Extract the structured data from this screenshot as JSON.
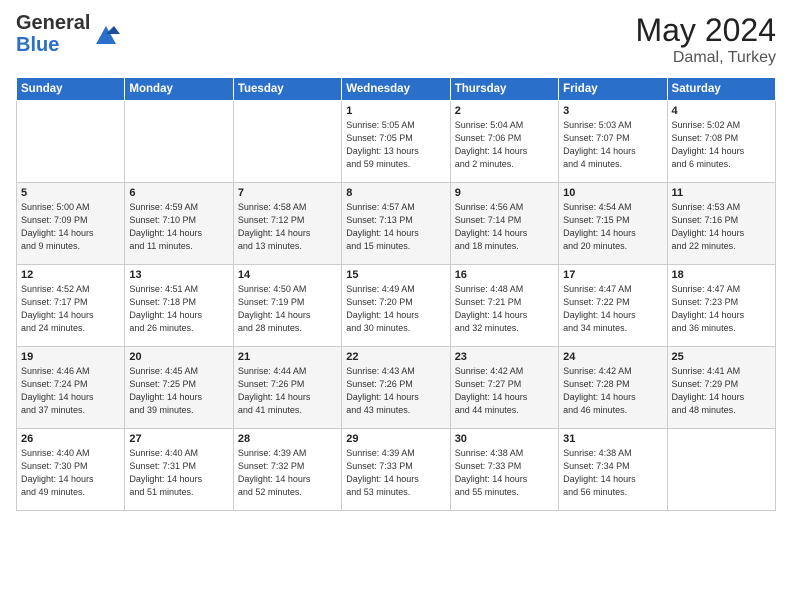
{
  "header": {
    "title": "May 2024",
    "location": "Damal, Turkey",
    "logo_general": "General",
    "logo_blue": "Blue"
  },
  "days_of_week": [
    "Sunday",
    "Monday",
    "Tuesday",
    "Wednesday",
    "Thursday",
    "Friday",
    "Saturday"
  ],
  "weeks": [
    [
      {
        "day": "",
        "detail": ""
      },
      {
        "day": "",
        "detail": ""
      },
      {
        "day": "",
        "detail": ""
      },
      {
        "day": "1",
        "detail": "Sunrise: 5:05 AM\nSunset: 7:05 PM\nDaylight: 13 hours\nand 59 minutes."
      },
      {
        "day": "2",
        "detail": "Sunrise: 5:04 AM\nSunset: 7:06 PM\nDaylight: 14 hours\nand 2 minutes."
      },
      {
        "day": "3",
        "detail": "Sunrise: 5:03 AM\nSunset: 7:07 PM\nDaylight: 14 hours\nand 4 minutes."
      },
      {
        "day": "4",
        "detail": "Sunrise: 5:02 AM\nSunset: 7:08 PM\nDaylight: 14 hours\nand 6 minutes."
      }
    ],
    [
      {
        "day": "5",
        "detail": "Sunrise: 5:00 AM\nSunset: 7:09 PM\nDaylight: 14 hours\nand 9 minutes."
      },
      {
        "day": "6",
        "detail": "Sunrise: 4:59 AM\nSunset: 7:10 PM\nDaylight: 14 hours\nand 11 minutes."
      },
      {
        "day": "7",
        "detail": "Sunrise: 4:58 AM\nSunset: 7:12 PM\nDaylight: 14 hours\nand 13 minutes."
      },
      {
        "day": "8",
        "detail": "Sunrise: 4:57 AM\nSunset: 7:13 PM\nDaylight: 14 hours\nand 15 minutes."
      },
      {
        "day": "9",
        "detail": "Sunrise: 4:56 AM\nSunset: 7:14 PM\nDaylight: 14 hours\nand 18 minutes."
      },
      {
        "day": "10",
        "detail": "Sunrise: 4:54 AM\nSunset: 7:15 PM\nDaylight: 14 hours\nand 20 minutes."
      },
      {
        "day": "11",
        "detail": "Sunrise: 4:53 AM\nSunset: 7:16 PM\nDaylight: 14 hours\nand 22 minutes."
      }
    ],
    [
      {
        "day": "12",
        "detail": "Sunrise: 4:52 AM\nSunset: 7:17 PM\nDaylight: 14 hours\nand 24 minutes."
      },
      {
        "day": "13",
        "detail": "Sunrise: 4:51 AM\nSunset: 7:18 PM\nDaylight: 14 hours\nand 26 minutes."
      },
      {
        "day": "14",
        "detail": "Sunrise: 4:50 AM\nSunset: 7:19 PM\nDaylight: 14 hours\nand 28 minutes."
      },
      {
        "day": "15",
        "detail": "Sunrise: 4:49 AM\nSunset: 7:20 PM\nDaylight: 14 hours\nand 30 minutes."
      },
      {
        "day": "16",
        "detail": "Sunrise: 4:48 AM\nSunset: 7:21 PM\nDaylight: 14 hours\nand 32 minutes."
      },
      {
        "day": "17",
        "detail": "Sunrise: 4:47 AM\nSunset: 7:22 PM\nDaylight: 14 hours\nand 34 minutes."
      },
      {
        "day": "18",
        "detail": "Sunrise: 4:47 AM\nSunset: 7:23 PM\nDaylight: 14 hours\nand 36 minutes."
      }
    ],
    [
      {
        "day": "19",
        "detail": "Sunrise: 4:46 AM\nSunset: 7:24 PM\nDaylight: 14 hours\nand 37 minutes."
      },
      {
        "day": "20",
        "detail": "Sunrise: 4:45 AM\nSunset: 7:25 PM\nDaylight: 14 hours\nand 39 minutes."
      },
      {
        "day": "21",
        "detail": "Sunrise: 4:44 AM\nSunset: 7:26 PM\nDaylight: 14 hours\nand 41 minutes."
      },
      {
        "day": "22",
        "detail": "Sunrise: 4:43 AM\nSunset: 7:26 PM\nDaylight: 14 hours\nand 43 minutes."
      },
      {
        "day": "23",
        "detail": "Sunrise: 4:42 AM\nSunset: 7:27 PM\nDaylight: 14 hours\nand 44 minutes."
      },
      {
        "day": "24",
        "detail": "Sunrise: 4:42 AM\nSunset: 7:28 PM\nDaylight: 14 hours\nand 46 minutes."
      },
      {
        "day": "25",
        "detail": "Sunrise: 4:41 AM\nSunset: 7:29 PM\nDaylight: 14 hours\nand 48 minutes."
      }
    ],
    [
      {
        "day": "26",
        "detail": "Sunrise: 4:40 AM\nSunset: 7:30 PM\nDaylight: 14 hours\nand 49 minutes."
      },
      {
        "day": "27",
        "detail": "Sunrise: 4:40 AM\nSunset: 7:31 PM\nDaylight: 14 hours\nand 51 minutes."
      },
      {
        "day": "28",
        "detail": "Sunrise: 4:39 AM\nSunset: 7:32 PM\nDaylight: 14 hours\nand 52 minutes."
      },
      {
        "day": "29",
        "detail": "Sunrise: 4:39 AM\nSunset: 7:33 PM\nDaylight: 14 hours\nand 53 minutes."
      },
      {
        "day": "30",
        "detail": "Sunrise: 4:38 AM\nSunset: 7:33 PM\nDaylight: 14 hours\nand 55 minutes."
      },
      {
        "day": "31",
        "detail": "Sunrise: 4:38 AM\nSunset: 7:34 PM\nDaylight: 14 hours\nand 56 minutes."
      },
      {
        "day": "",
        "detail": ""
      }
    ]
  ]
}
